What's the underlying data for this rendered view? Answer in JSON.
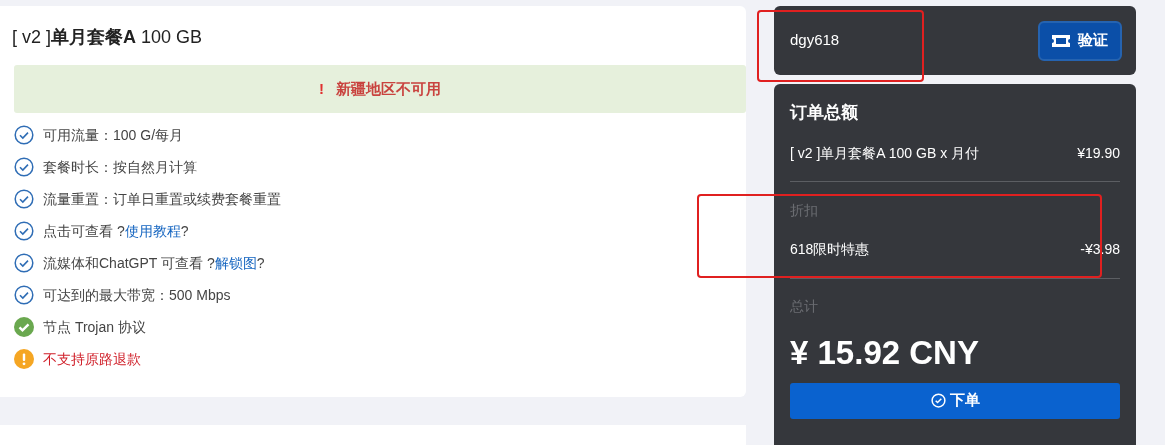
{
  "plan": {
    "title": "[ v2 ]**单月套餐A** 100 GB",
    "notice": {
      "icon": "!",
      "text": "新疆地区不可用"
    },
    "features": [
      {
        "kind": "check",
        "text": "可用流量：100 G/每月"
      },
      {
        "kind": "check",
        "text": "套餐时长：按自然月计算"
      },
      {
        "kind": "check",
        "text": "流量重置：订单日重置或续费套餐重置"
      },
      {
        "kind": "check",
        "text": "点击可查看 ?",
        "link": "使用教程",
        "suffix": "?"
      },
      {
        "kind": "check",
        "text": "流媒体和ChatGPT 可查看 ?",
        "link": "解锁图",
        "suffix": "?"
      },
      {
        "kind": "check",
        "text": "可达到的最大带宽：500 Mbps"
      },
      {
        "kind": "ok",
        "text": "节点 Trojan 协议"
      },
      {
        "kind": "warn",
        "text": "不支持原路退款"
      }
    ]
  },
  "coupon": {
    "value": "dgy618",
    "button": "验证"
  },
  "order": {
    "title": "订单总额",
    "item": {
      "name": "[ v2 ]单月套餐A 100 GB x 月付",
      "price": "¥19.90"
    },
    "discount_label": "折扣",
    "discount": {
      "name": "618限时特惠",
      "amount": "-¥3.98"
    },
    "total_label": "总计",
    "total": "¥ 15.92 CNY",
    "submit": "下单"
  }
}
